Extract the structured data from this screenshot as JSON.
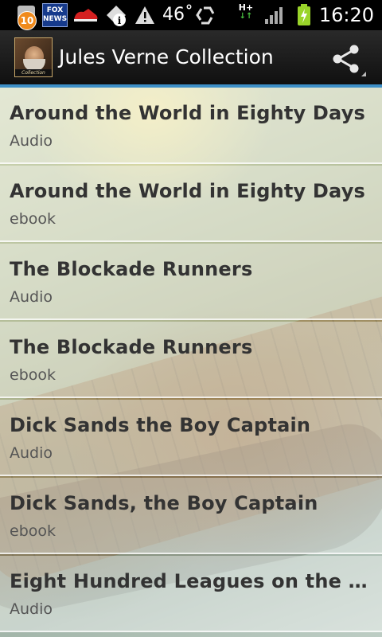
{
  "status_bar": {
    "notification_count": "10",
    "news_icon_text": [
      "FOX",
      "NEWS"
    ],
    "temperature": "46˚",
    "network_type": "H+",
    "time": "16:20"
  },
  "app_bar": {
    "title": "Jules Verne Collection",
    "app_icon_caption": "Collection",
    "accent_color": "#3d8fc7"
  },
  "list": {
    "items": [
      {
        "title": "Around the World in Eighty Days",
        "subtitle": "Audio"
      },
      {
        "title": "Around the World in Eighty Days",
        "subtitle": "ebook"
      },
      {
        "title": "The Blockade Runners",
        "subtitle": "Audio"
      },
      {
        "title": "The Blockade Runners",
        "subtitle": "ebook"
      },
      {
        "title": "Dick Sands the Boy Captain",
        "subtitle": "Audio"
      },
      {
        "title": "Dick Sands, the Boy Captain",
        "subtitle": "ebook"
      },
      {
        "title": "Eight Hundred Leagues on the A…",
        "subtitle": "Audio"
      }
    ]
  }
}
